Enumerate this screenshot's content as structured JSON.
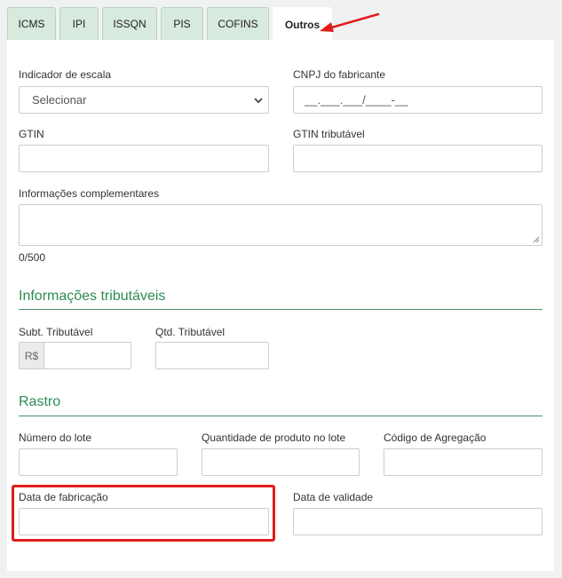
{
  "tabs": [
    {
      "label": "ICMS"
    },
    {
      "label": "IPI"
    },
    {
      "label": "ISSQN"
    },
    {
      "label": "PIS"
    },
    {
      "label": "COFINS"
    },
    {
      "label": "Outros",
      "active": true
    }
  ],
  "fields": {
    "indicador_escala": {
      "label": "Indicador de escala",
      "selected": "Selecionar"
    },
    "cnpj_fabricante": {
      "label": "CNPJ do fabricante",
      "placeholder": "__.___.___/____-__"
    },
    "gtin": {
      "label": "GTIN",
      "value": ""
    },
    "gtin_tributavel": {
      "label": "GTIN tributável",
      "value": ""
    },
    "info_complementares": {
      "label": "Informações complementares",
      "value": "",
      "counter": "0/500"
    }
  },
  "tributaveis": {
    "title": "Informações tributáveis",
    "subt_tributavel": {
      "label": "Subt. Tributável",
      "prefix": "R$",
      "value": ""
    },
    "qtd_tributavel": {
      "label": "Qtd. Tributável",
      "value": ""
    }
  },
  "rastro": {
    "title": "Rastro",
    "numero_lote": {
      "label": "Número do lote",
      "value": ""
    },
    "quantidade_lote": {
      "label": "Quantidade de produto no lote",
      "value": ""
    },
    "codigo_agregacao": {
      "label": "Código de Agregação",
      "value": ""
    },
    "data_fabricacao": {
      "label": "Data de fabricação",
      "value": ""
    },
    "data_validade": {
      "label": "Data de validade",
      "value": ""
    }
  },
  "annotations": {
    "highlight_color": "#e11b1b",
    "accent_color": "#2e8b57"
  }
}
